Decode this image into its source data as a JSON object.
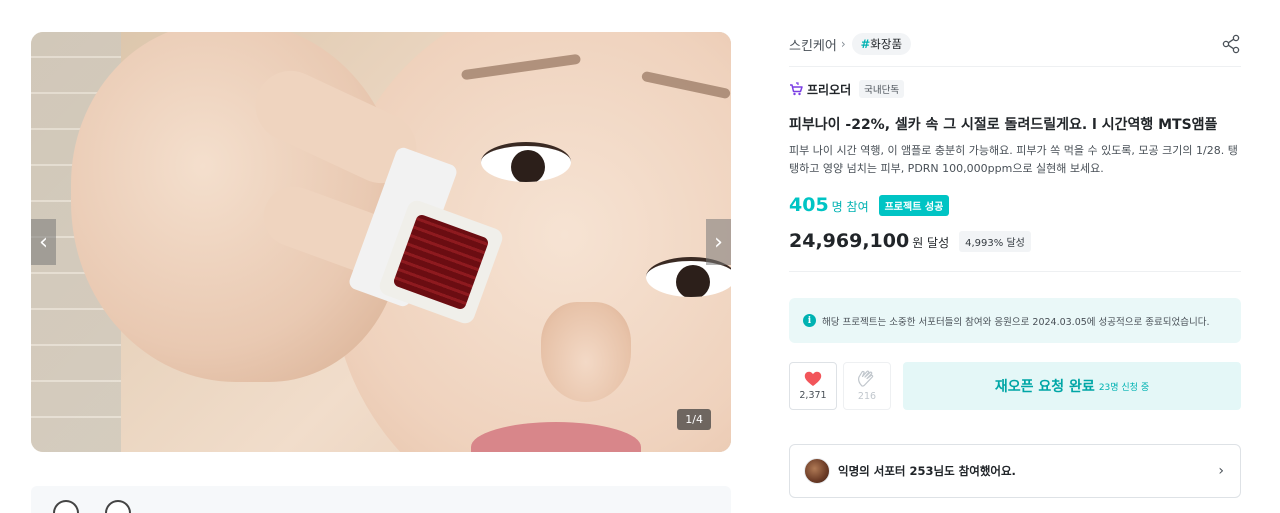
{
  "gallery": {
    "prev_icon": "chevron-left-icon",
    "next_icon": "chevron-right-icon",
    "counter": "1/4"
  },
  "breadcrumb": {
    "category": "스킨케어",
    "tag_hash": "#",
    "tag_label": "화장품"
  },
  "maker": {
    "name": "프리오더",
    "badge": "국내단독"
  },
  "project": {
    "title": "피부나이 -22%, 셀카 속 그 시절로 돌려드릴게요. l 시간역행 MTS앰플",
    "description": "피부 나이 시간 역행, 이 앰플로 충분히 가능해요. 피부가 쏙 먹을 수 있도록, 모공 크기의 1/28. 탱탱하고 영양 넘치는 피부, PDRN 100,000ppm으로 실현해 보세요."
  },
  "stats": {
    "participants": "405",
    "participants_unit": "명 참여",
    "status_badge": "프로젝트 성공",
    "amount": "24,969,100",
    "amount_unit": "원 달성",
    "percent": "4,993% 달성"
  },
  "notice": {
    "icon": "i",
    "text": "해당 프로젝트는 소중한 서포터들의 참여와 응원으로 2024.03.05에 성공적으로 종료되었습니다."
  },
  "actions": {
    "like_count": "2,371",
    "cheer_count": "216",
    "reopen_label": "재오픈 요청 완료",
    "reopen_sub": "23명 신청 중"
  },
  "supporters": {
    "text": "익명의 서포터 253님도 참여했어요."
  },
  "colors": {
    "accent": "#00c4c4",
    "heart": "#f2555a",
    "notice_bg": "#eaf8f8"
  }
}
